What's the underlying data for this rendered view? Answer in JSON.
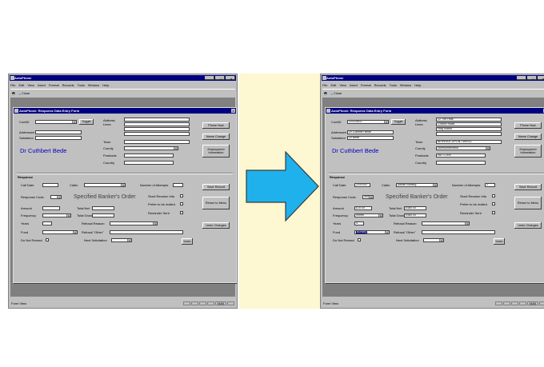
{
  "app": {
    "title": "AutoPhone",
    "form_title": "AutoPhone: Response Data Entry Form",
    "status_text": "Form View",
    "status_indicator": "NUM"
  },
  "menu": [
    "File",
    "Edit",
    "View",
    "Insert",
    "Format",
    "Records",
    "Tools",
    "Window",
    "Help"
  ],
  "toolbar": {
    "close_label": "Close"
  },
  "labels": {
    "contid": "ContID",
    "toggle": "Toggle",
    "address_lines": "Address Lines",
    "addressee": "Addressee",
    "salutation": "Salutation",
    "town": "Town",
    "county": "County",
    "postcode": "Postcode",
    "country": "Country",
    "phone_now": "Phone Now",
    "name_change": "Name Change",
    "employment_information": "Employment Information",
    "response": "Response",
    "call_date": "Call Date",
    "caller": "Caller",
    "number_of_attempts": "Number of Attempts",
    "save_record": "Save Record",
    "return_to_menu": "Return to Menu",
    "response_code": "Response Code",
    "send_reunion_info": "Send Reunion Info",
    "prefer_to_be_mailed": "Prefer to be mailed",
    "reminder_sent": "Reminder Sent",
    "amount": "Amount",
    "total_net": "Total Net",
    "frequency": "Frequency",
    "total_gross": "Total Gross",
    "years": "Years",
    "refusal_reason": "Refusal Reason",
    "undo_changes": "Undo Changes",
    "fund": "Fund",
    "refusal_other": "Refusal \"Other\"",
    "do_not_reread": "Do Not Reread",
    "next_solicitation": "Next Solicitation",
    "undo": "Undo"
  },
  "before": {
    "contid": "",
    "address_lines": [
      "",
      "",
      "",
      ""
    ],
    "addressee": "",
    "salutation": "",
    "display_name": "Dr Cuthbert Bede",
    "town": "",
    "county": "",
    "postcode": "",
    "country": "",
    "call_date": "",
    "caller": "",
    "number_of_attempts": "",
    "response_code": "",
    "response_description": "Specified Banker's Order",
    "amount": "",
    "total_net": "",
    "frequency": "",
    "total_gross": "",
    "years": "",
    "refusal_reason": "",
    "fund": "",
    "refusal_other": "",
    "next_solicitation": ""
  },
  "after": {
    "contid": "12312623",
    "address_lines": [
      "12 The Huts",
      "Church Road",
      "Holy Island",
      ""
    ],
    "addressee": "Dr Cuthbert Bede",
    "salutation": "Dr Bede",
    "display_name": "Dr Cuthbert Bede",
    "town": "BERWICK-UPON-TWEED",
    "county": "Northumberland",
    "postcode": "NE71 2RE",
    "country": "",
    "call_date": "22/01/02",
    "caller": "Adrian Bonsey",
    "number_of_attempts": "2",
    "response_code": "SBO",
    "response_description": "Specified Banker's Order",
    "amount": "£10.00",
    "total_net": "£480.00",
    "frequency": "month",
    "total_gross": "£480.00",
    "years": "4",
    "refusal_reason": "",
    "fund": "Bursary",
    "refusal_other": "",
    "next_solicitation": ""
  },
  "colors": {
    "arrow": "#1fb1ec",
    "title_bar": "#000080",
    "name_text": "#0000c0"
  }
}
